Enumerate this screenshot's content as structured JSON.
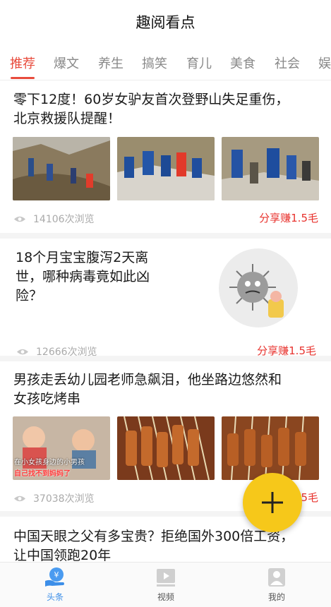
{
  "app": {
    "title": "趣阅看点"
  },
  "tabs": [
    {
      "label": "推荐",
      "active": true
    },
    {
      "label": "爆文"
    },
    {
      "label": "养生"
    },
    {
      "label": "搞笑"
    },
    {
      "label": "育儿"
    },
    {
      "label": "美食"
    },
    {
      "label": "社会"
    },
    {
      "label": "娱"
    }
  ],
  "articles": [
    {
      "title_line1": "零下12度！60岁女驴友首次登野山失足重伤，",
      "title_line2": "北京救援队提醒！",
      "views": "14106次浏览",
      "share": "分享赚1.5毛"
    },
    {
      "title_line1": "18个月宝宝腹泻2天离",
      "title_line2": "世，哪种病毒竟如此凶",
      "title_line3": "险？",
      "views": "12666次浏览",
      "share": "分享赚1.5毛"
    },
    {
      "title_line1": "男孩走丢幼儿园老师急飙泪，他坐路边悠然和",
      "title_line2": "女孩吃烤串",
      "views": "37038次浏览",
      "share": "5毛",
      "thumb_caption1": "在小女孩身边的小男孩",
      "thumb_caption2": "自己找不到妈妈了"
    },
    {
      "title_line1": "中国天眼之父有多宝贵？拒绝国外300倍工资，",
      "title_line2": "让中国领跑20年"
    }
  ],
  "fab": {
    "icon": "plus-icon"
  },
  "bottom_nav": [
    {
      "label": "头条",
      "icon": "coin-hand-icon",
      "active": true
    },
    {
      "label": "视频",
      "icon": "video-play-icon"
    },
    {
      "label": "我的",
      "icon": "user-icon"
    }
  ],
  "colors": {
    "accent": "#e84b3c",
    "share": "#e8322d",
    "fab": "#f6c81a",
    "nav_active": "#3c8ee8"
  }
}
